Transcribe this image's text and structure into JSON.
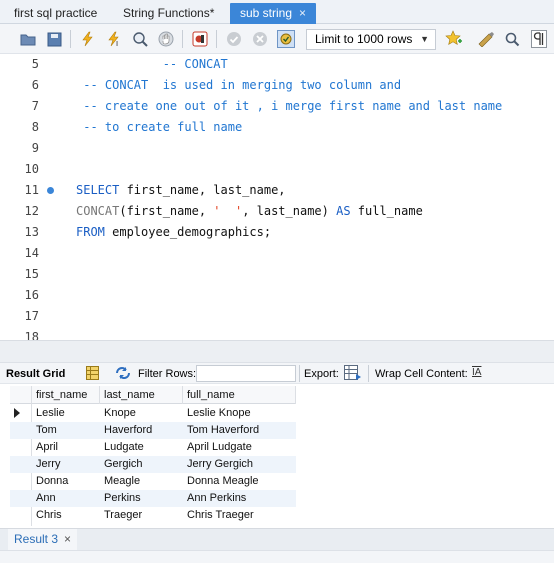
{
  "tabs": [
    {
      "label": "first sql practice",
      "active": false
    },
    {
      "label": "String Functions*",
      "active": false
    },
    {
      "label": "sub string",
      "active": true
    }
  ],
  "tab_close_glyph": "×",
  "toolbar": {
    "limit_label": "Limit to 1000 rows",
    "icons": [
      "folder-icon",
      "save-icon",
      "execute-icon",
      "execute-current-icon",
      "explain-icon",
      "stop-icon",
      "toggle-continue-icon",
      "commit-icon",
      "rollback-icon",
      "autocommit-icon",
      "beautify-icon",
      "bookmark-icon",
      "find-icon",
      "invisibles-icon"
    ]
  },
  "editor": {
    "lines": [
      {
        "num": "5",
        "segments": [
          {
            "t": "            -- CONCAT",
            "c": "cm"
          }
        ]
      },
      {
        "num": "6",
        "segments": [
          {
            "t": " -- CONCAT  is used in merging two column and",
            "c": "cm"
          }
        ]
      },
      {
        "num": "7",
        "segments": [
          {
            "t": " -- create one out of it , i merge first name and last name",
            "c": "cm"
          }
        ]
      },
      {
        "num": "8",
        "segments": [
          {
            "t": " -- to create full name",
            "c": "cm"
          }
        ]
      },
      {
        "num": "9",
        "segments": []
      },
      {
        "num": "10",
        "segments": []
      },
      {
        "num": "11",
        "dot": true,
        "segments": [
          {
            "t": "SELECT",
            "c": "kw"
          },
          {
            "t": " first_name, last_name,",
            "c": "plain"
          }
        ]
      },
      {
        "num": "12",
        "segments": [
          {
            "t": "CONCAT",
            "c": "fn"
          },
          {
            "t": "(first_name, ",
            "c": "plain"
          },
          {
            "t": "'  '",
            "c": "str"
          },
          {
            "t": ", last_name) ",
            "c": "plain"
          },
          {
            "t": "AS",
            "c": "kw"
          },
          {
            "t": " full_name",
            "c": "plain"
          }
        ]
      },
      {
        "num": "13",
        "segments": [
          {
            "t": "FROM",
            "c": "kw"
          },
          {
            "t": " employee_demographics;",
            "c": "plain"
          }
        ]
      },
      {
        "num": "14",
        "segments": []
      },
      {
        "num": "15",
        "segments": []
      },
      {
        "num": "16",
        "segments": []
      },
      {
        "num": "17",
        "segments": []
      },
      {
        "num": "18",
        "segments": []
      }
    ]
  },
  "result_toolbar": {
    "result_grid_label": "Result Grid",
    "filter_label": "Filter Rows:",
    "export_label": "Export:",
    "wrap_label": "Wrap Cell Content:",
    "wrap_icon_text": "IA"
  },
  "grid": {
    "columns": [
      "first_name",
      "last_name",
      "full_name"
    ],
    "rows": [
      [
        "Leslie",
        "Knope",
        "Leslie  Knope"
      ],
      [
        "Tom",
        "Haverford",
        "Tom  Haverford"
      ],
      [
        "April",
        "Ludgate",
        "April  Ludgate"
      ],
      [
        "Jerry",
        "Gergich",
        "Jerry  Gergich"
      ],
      [
        "Donna",
        "Meagle",
        "Donna  Meagle"
      ],
      [
        "Ann",
        "Perkins",
        "Ann  Perkins"
      ],
      [
        "Chris",
        "Traeger",
        "Chris  Traeger"
      ]
    ]
  },
  "bottom_tab": {
    "label": "Result 3"
  },
  "colors": {
    "accent": "#3b86d8",
    "keyword": "#1a5ec4",
    "comment": "#2176d1",
    "string": "#e23f1e"
  }
}
